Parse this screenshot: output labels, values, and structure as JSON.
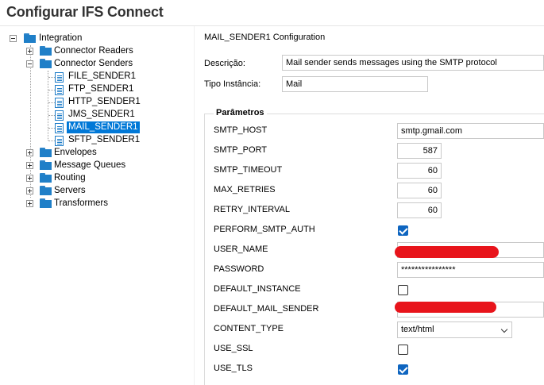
{
  "app": {
    "title": "Configurar IFS Connect"
  },
  "tree": {
    "root": "Integration",
    "readers": "Connector Readers",
    "senders": "Connector Senders",
    "sender_items": [
      "FILE_SENDER1",
      "FTP_SENDER1",
      "HTTP_SENDER1",
      "JMS_SENDER1",
      "MAIL_SENDER1",
      "SFTP_SENDER1"
    ],
    "others": [
      "Envelopes",
      "Message Queues",
      "Routing",
      "Servers",
      "Transformers"
    ],
    "selected": "MAIL_SENDER1"
  },
  "config": {
    "heading": "MAIL_SENDER1 Configuration",
    "descricao_label": "Descrição:",
    "descricao_value": "Mail sender sends messages using the SMTP protocol",
    "tipo_label": "Tipo Instância:",
    "tipo_value": "Mail",
    "params_title": "Parâmetros"
  },
  "params": {
    "smtp_host": {
      "label": "SMTP_HOST",
      "value": "smtp.gmail.com"
    },
    "smtp_port": {
      "label": "SMTP_PORT",
      "value": "587"
    },
    "smtp_timeout": {
      "label": "SMTP_TIMEOUT",
      "value": "60"
    },
    "max_retries": {
      "label": "MAX_RETRIES",
      "value": "60"
    },
    "retry_interval": {
      "label": "RETRY_INTERVAL",
      "value": "60"
    },
    "perform_smtp_auth": {
      "label": "PERFORM_SMTP_AUTH",
      "checked": true
    },
    "user_name": {
      "label": "USER_NAME",
      "value": ""
    },
    "password": {
      "label": "PASSWORD",
      "value": "****************"
    },
    "default_instance": {
      "label": "DEFAULT_INSTANCE",
      "checked": false
    },
    "default_mail_sender": {
      "label": "DEFAULT_MAIL_SENDER",
      "value": ""
    },
    "content_type": {
      "label": "CONTENT_TYPE",
      "value": "text/html"
    },
    "use_ssl": {
      "label": "USE_SSL",
      "checked": false
    },
    "use_tls": {
      "label": "USE_TLS",
      "checked": true
    }
  },
  "colors": {
    "selection": "#0078d7",
    "folder": "#1f7fc8",
    "checkbox_checked": "#0e65c0",
    "redaction": "#e8141b"
  }
}
